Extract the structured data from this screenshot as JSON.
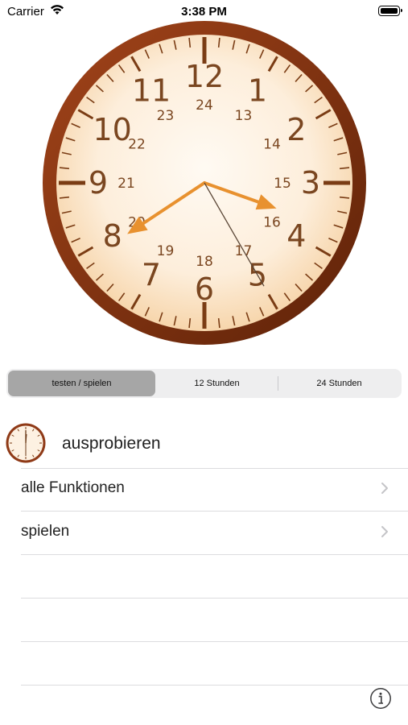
{
  "status_bar": {
    "carrier": "Carrier",
    "time": "3:38 PM"
  },
  "clock": {
    "hour_numerals": [
      "12",
      "1",
      "2",
      "3",
      "4",
      "5",
      "6",
      "7",
      "8",
      "9",
      "10",
      "11"
    ],
    "inner_numerals": [
      "24",
      "13",
      "14",
      "15",
      "16",
      "17",
      "18",
      "19",
      "20",
      "21",
      "22",
      "23"
    ],
    "time_shown": {
      "hour": 3,
      "minute": 39,
      "second": 25
    },
    "hand_color": "#e8912f",
    "rim_color": "#8f3a17"
  },
  "segmented_control": {
    "items": [
      "testen / spielen",
      "12 Stunden",
      "24 Stunden"
    ],
    "selected_index": 0
  },
  "header": {
    "title": "ausprobieren"
  },
  "list": [
    {
      "label": "alle Funktionen"
    },
    {
      "label": "spielen"
    }
  ]
}
